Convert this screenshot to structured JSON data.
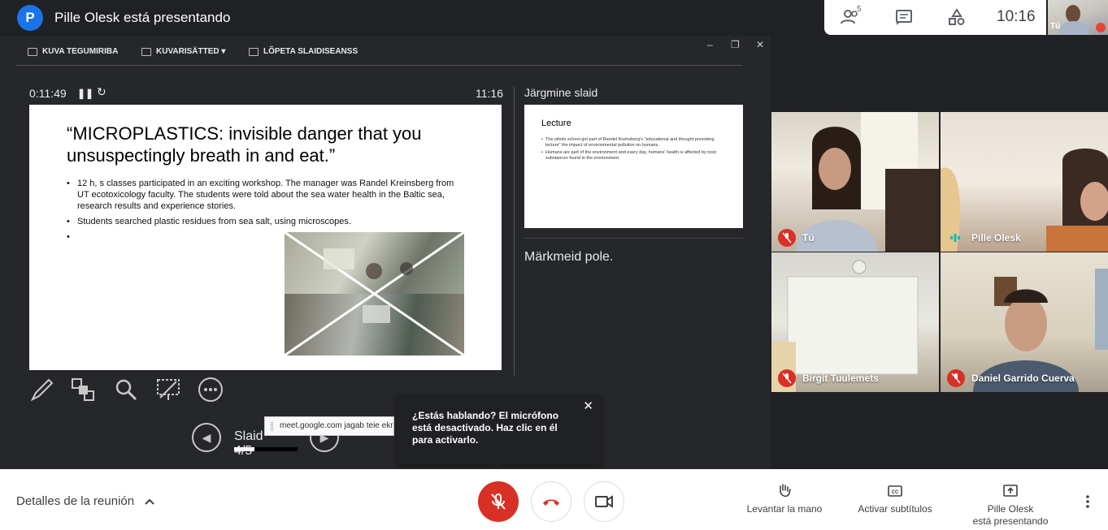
{
  "header": {
    "avatar_letter": "P",
    "title": "Pille Olesk está presentando",
    "people_count": "5",
    "time": "10:16",
    "self_label": "Tú"
  },
  "presenter_view": {
    "toolbar": [
      "KUVA TEGUMIRIBA",
      "KUVARISÄTTED ▾",
      "LÕPETA SLAIDISEANSS"
    ],
    "timer": "0:11:49",
    "current_time": "11:16",
    "slide": {
      "title": "“MICROPLASTICS: invisible danger that you unsuspectingly breath in and eat.”",
      "bullets": [
        "12 h, s classes participated in an exciting workshop. The manager was Randel Kreinsberg from UT ecotoxicology faculty. The students were told about the sea water health in the Baltic sea, research results  and experience stories.",
        "Students searched plastic residues from sea salt, using microscopes.",
        ""
      ]
    },
    "next_slide_label": "Järgmine slaid",
    "next_slide": {
      "title": "Lecture",
      "bullets": [
        "The whole school got part of Randel Kreinsberg's \"educational and thought provoking lecture\" the impact of environmental pollution on humans.",
        "Humans are part of the environment and every day, humans' health is affected by toxic substances found in the environment."
      ]
    },
    "notes": "Märkmeid pole.",
    "slide_nav_label": "Slaid 4/5",
    "slide_progress": 0.32,
    "url_tooltip": "meet.google.com jagab teie ekraani."
  },
  "toast": {
    "text": "¿Estás hablando? El micrófono está desactivado. Haz clic en él para activarlo."
  },
  "participants": [
    {
      "name": "Tú",
      "muted": true
    },
    {
      "name": "Pille Olesk",
      "muted": false
    },
    {
      "name": "Birgit Tuulemets",
      "muted": true
    },
    {
      "name": "Daniel Garrido Cuerva",
      "muted": true
    }
  ],
  "bottombar": {
    "meeting_details": "Detalles de la reunión",
    "raise_hand": "Levantar la mano",
    "captions": "Activar subtítulos",
    "presenting_line1": "Pille Olesk",
    "presenting_line2": "está presentando"
  },
  "colors": {
    "accent_blue": "#1a73e8",
    "mic_red": "#d93025",
    "dark_bg": "#202124"
  }
}
